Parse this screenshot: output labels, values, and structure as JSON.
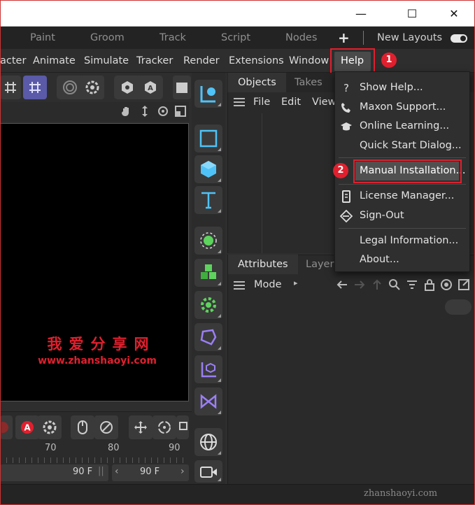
{
  "window": {
    "minimize_glyph": "—",
    "maximize_glyph": "☐",
    "close_glyph": "✕"
  },
  "layout_tabs": [
    {
      "label": "Paint"
    },
    {
      "label": "Groom"
    },
    {
      "label": "Track"
    },
    {
      "label": "Script"
    },
    {
      "label": "Nodes"
    }
  ],
  "layout_add_glyph": "+",
  "new_layouts_label": "New Layouts",
  "menus": [
    {
      "label": "acter"
    },
    {
      "label": "Animate"
    },
    {
      "label": "Simulate"
    },
    {
      "label": "Tracker"
    },
    {
      "label": "Render"
    },
    {
      "label": "Extensions"
    },
    {
      "label": "Window"
    },
    {
      "label": "Help"
    }
  ],
  "step_badges": {
    "one": "1",
    "two": "2"
  },
  "help_menu": {
    "items": [
      {
        "label": "Show Help...",
        "icon": "question-icon"
      },
      {
        "label": "Maxon Support...",
        "icon": "phone-icon"
      },
      {
        "label": "Online Learning...",
        "icon": "graduation-cap-icon"
      },
      {
        "label": "Quick Start Dialog...",
        "icon": ""
      },
      {
        "label": "Manual Installation...",
        "icon": ""
      },
      {
        "label": "License Manager...",
        "icon": "license-icon"
      },
      {
        "label": "Sign-Out",
        "icon": "sign-out-icon"
      },
      {
        "label": "Legal Information...",
        "icon": ""
      },
      {
        "label": "About...",
        "icon": ""
      }
    ]
  },
  "objects_panel": {
    "tabs": [
      {
        "label": "Objects"
      },
      {
        "label": "Takes"
      }
    ],
    "menu": [
      {
        "label": "File"
      },
      {
        "label": "Edit"
      },
      {
        "label": "View"
      }
    ]
  },
  "attributes_panel": {
    "tabs": [
      {
        "label": "Attributes"
      },
      {
        "label": "Layers"
      }
    ],
    "mode_label": "Mode"
  },
  "viewport": {
    "watermark_cn": "我爱分享网",
    "watermark_url": "www.zhanshaoyi.com"
  },
  "timeline": {
    "ticks": [
      "70",
      "80",
      "90"
    ],
    "end_frame": "90 F",
    "max_frame": "90 F"
  },
  "footer_watermark": "zhanshaoyi.com",
  "colors": {
    "highlight_red": "#e0202e",
    "accent_blue": "#4fc3f7",
    "accent_green": "#5ed35e"
  }
}
